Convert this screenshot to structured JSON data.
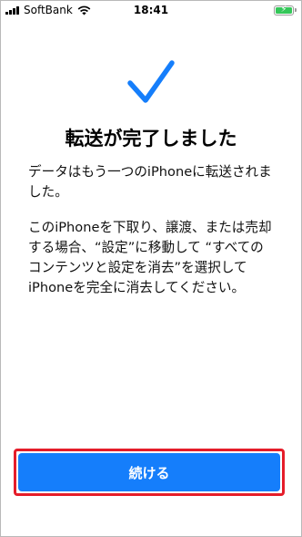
{
  "status_bar": {
    "carrier": "SoftBank",
    "time": "18:41",
    "battery_color": "#34c759",
    "icons": [
      "signal-icon",
      "wifi-icon",
      "battery-charging-icon"
    ]
  },
  "checkmark": {
    "icon": "checkmark-icon",
    "color": "#157efb"
  },
  "title": "転送が完了しました",
  "paragraphs": [
    "データはもう一つのiPhoneに転送されました。",
    "このiPhoneを下取り、譲渡、または売却する場合、“設定”に移動して “すべてのコンテンツと設定を消去”を選択してiPhoneを完全に消去してください。"
  ],
  "continue_button": {
    "label": "続ける",
    "color": "#157efb",
    "highlight_color": "#e51d2a"
  }
}
